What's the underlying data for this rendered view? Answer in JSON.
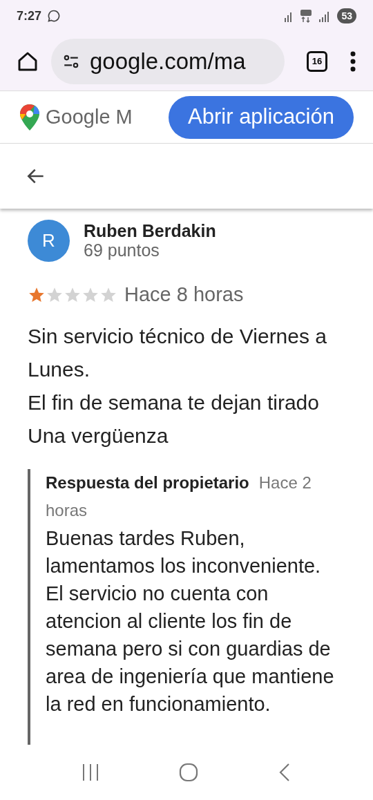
{
  "status_bar": {
    "time": "7:27",
    "battery": "53"
  },
  "browser": {
    "url": "google.com/ma",
    "tab_count": "16"
  },
  "maps_header": {
    "brand": "Google M",
    "open_app_button": "Abrir aplicación"
  },
  "review": {
    "avatar_letter": "R",
    "author": "Ruben Berdakin",
    "points": "69 puntos",
    "stars": 1,
    "time": "Hace 8 horas",
    "lines": [
      "Sin servicio técnico de Viernes a Lunes.",
      "El fin de semana te dejan tirado",
      "Una vergüenza"
    ],
    "owner_reply": {
      "title": "Respuesta del propietario",
      "time": "Hace 2 horas",
      "text": "Buenas tardes Ruben, lamentamos los inconveniente.  El servicio no cuenta con atencion al cliente los fin de semana pero si con guardias de area de ingeniería que mantiene la red en funcionamiento."
    }
  }
}
